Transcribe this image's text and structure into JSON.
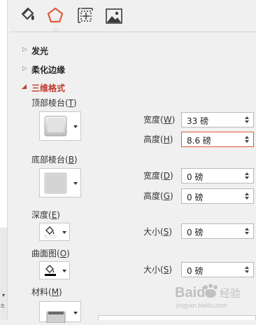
{
  "left_strip": {
    "arrow": "▾",
    "tick": "±"
  },
  "tabs": [
    {
      "name": "fill-line-tab",
      "icon": "paint-bucket-icon"
    },
    {
      "name": "effects-tab",
      "icon": "pentagon-icon",
      "active": true
    },
    {
      "name": "size-properties-tab",
      "icon": "size-position-icon"
    },
    {
      "name": "picture-tab",
      "icon": "picture-icon"
    }
  ],
  "sections": {
    "glow": {
      "arrow": "▷",
      "label": "发光"
    },
    "soft_edges": {
      "arrow": "▷",
      "label": "柔化边缘"
    },
    "format_3d": {
      "arrow": "◢",
      "label": "三维格式"
    }
  },
  "top_bevel": {
    "label": "顶部棱台(",
    "key": "T",
    "label_end": ")",
    "width_label": "宽度(",
    "width_key": "W",
    "width_value": "33 磅",
    "height_label": "高度(",
    "height_key": "H",
    "height_value": "8.6 磅"
  },
  "bottom_bevel": {
    "label": "底部棱台(",
    "key": "B",
    "label_end": ")",
    "width_label": "宽度(",
    "width_key": "D",
    "width_value": "0 磅",
    "height_label": "高度(",
    "height_key": "G",
    "height_value": "0 磅"
  },
  "depth": {
    "label": "深度(",
    "key": "E",
    "label_end": ")",
    "size_label": "大小(",
    "size_key": "S",
    "size_value": "0 磅"
  },
  "contour": {
    "label": "曲面图(",
    "key": "O",
    "label_end": ")",
    "size_label": "大小(",
    "size_key": "S",
    "size_value": "0 磅"
  },
  "material": {
    "label": "材料(",
    "key": "M",
    "label_end": ")"
  },
  "close_paren": ")",
  "colors": {
    "accent": "#c0392b",
    "focus_border": "#e05a3a",
    "panel": "#f0f0f0"
  },
  "watermark": {
    "brand": "Baidu",
    "brand_cn": "经验",
    "url": "jingyan.baidu.com"
  }
}
